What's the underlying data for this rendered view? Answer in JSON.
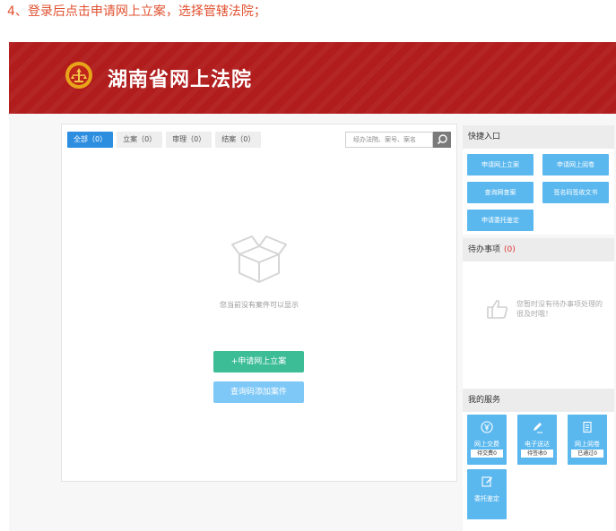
{
  "caption": "4、登录后点击申请网上立案，选择管辖法院；",
  "banner": {
    "title": "湖南省网上法院",
    "emblem_icon": "court-emblem-icon"
  },
  "tabs": [
    {
      "label": "全部（0）",
      "active": true
    },
    {
      "label": "立案（0）",
      "active": false
    },
    {
      "label": "审理（0）",
      "active": false
    },
    {
      "label": "结案（0）",
      "active": false
    }
  ],
  "search": {
    "placeholder": "经办法院、案号、案名",
    "icon": "search-icon"
  },
  "empty": {
    "icon": "open-box-icon",
    "text": "您当前没有案件可以显示"
  },
  "actions": {
    "apply": "+申请网上立案",
    "query": "查询码添加案件"
  },
  "quick": {
    "title": "快捷入口",
    "buttons": [
      "申请网上立案",
      "申请网上阅卷",
      "查询网查案",
      "签名码签收文书",
      "申请委托鉴定"
    ]
  },
  "todo": {
    "title": "待办事项",
    "count": "(0)",
    "icon": "thumbs-up-icon",
    "empty_text": "您暂时没有待办事项处理的很及时哦！"
  },
  "services": {
    "title": "我的服务",
    "items": [
      {
        "name": "网上交费",
        "badge": "待交费0",
        "icon": "yen-coin-icon"
      },
      {
        "name": "电子送达",
        "badge": "待签收0",
        "icon": "pen-icon"
      },
      {
        "name": "网上阅卷",
        "badge": "已通过0",
        "icon": "document-icon"
      },
      {
        "name": "委托鉴定",
        "badge": "",
        "icon": "edit-icon"
      }
    ]
  },
  "colors": {
    "banner": "#b11c1c",
    "tab_active": "#2d8ee0",
    "apply_button": "#3dbd96",
    "query_button": "#7ec8f7",
    "quick_button": "#5bb8ef",
    "caption": "#e0502f"
  }
}
